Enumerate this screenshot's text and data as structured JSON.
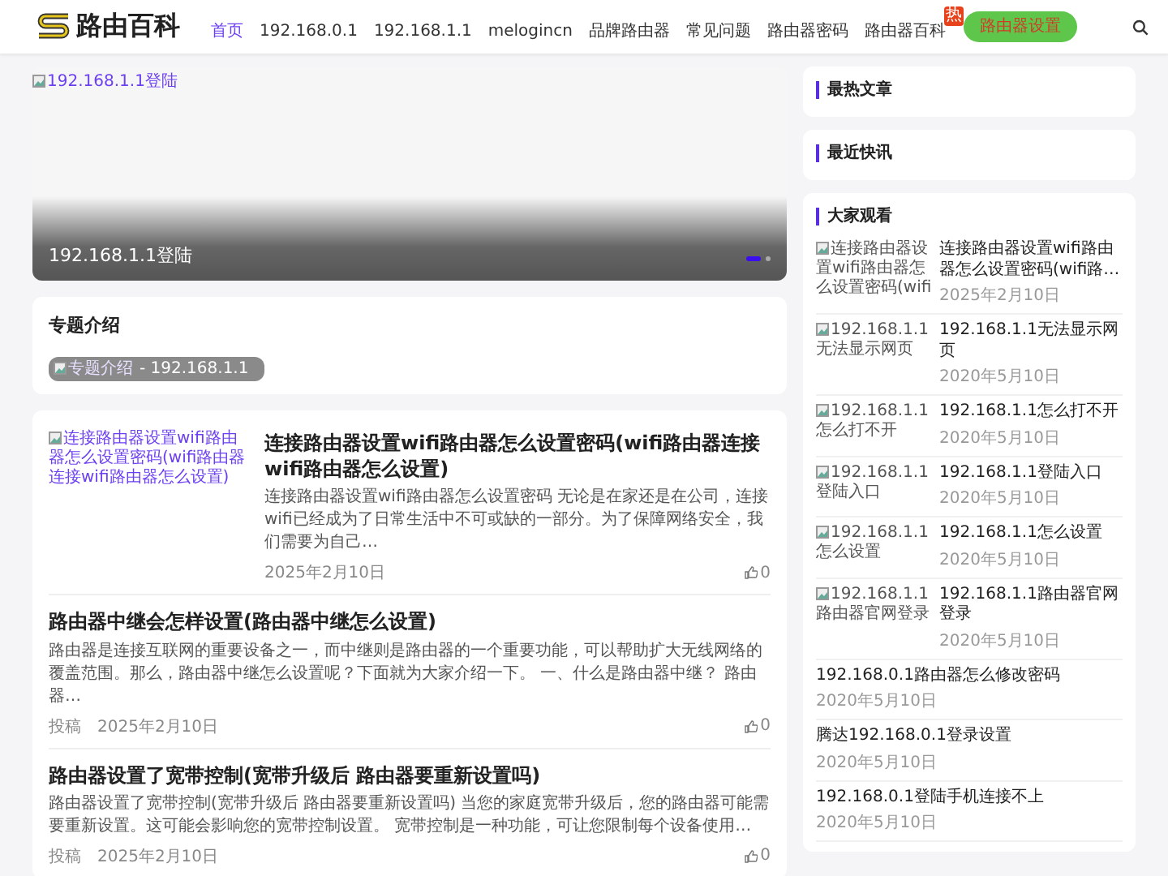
{
  "header": {
    "logo": "路由百科",
    "nav": [
      {
        "label": "首页",
        "selected": true
      },
      {
        "label": "192.168.0.1",
        "selected": false
      },
      {
        "label": "192.168.1.1",
        "selected": false
      },
      {
        "label": "melogincn",
        "selected": false
      },
      {
        "label": "品牌路由器",
        "selected": false
      },
      {
        "label": "常见问题",
        "selected": false
      },
      {
        "label": "路由器密码",
        "selected": false
      },
      {
        "label": "路由器百科",
        "selected": false,
        "badge": "热"
      }
    ],
    "cta": "路由器设置"
  },
  "slider": {
    "image_alt": "192.168.1.1登陆",
    "caption": "192.168.1.1登陆",
    "dots": [
      {
        "selected": true
      },
      {
        "selected": false
      }
    ]
  },
  "topic": {
    "title": "专题介绍",
    "image_alt": "专题介绍",
    "caption": "- 192.168.1.1"
  },
  "articles": [
    {
      "kind": "thumb",
      "image_alt": "连接路由器设置wifi路由器怎么设置密码(wifi路由器连接wifi路由器怎么设置)",
      "title": "连接路由器设置wifi路由器怎么设置密码(wifi路由器连接wifi路由器怎么设置)",
      "excerpt": "连接路由器设置wifi路由器怎么设置密码 无论是在家还是在公司，连接wifi已经成为了日常生活中不可或缺的一部分。为了保障网络安全，我们需要为自己…",
      "date": "2025年2月10日",
      "likes": "0"
    },
    {
      "kind": "plain",
      "title": "路由器中继会怎样设置(路由器中继怎么设置)",
      "excerpt": "路由器是连接互联网的重要设备之一，而中继则是路由器的一个重要功能，可以帮助扩大无线网络的覆盖范围。那么，路由器中继怎么设置呢？下面就为大家介绍一下。 一、什么是路由器中继？ 路由器…",
      "author": "投稿",
      "date": "2025年2月10日",
      "likes": "0"
    },
    {
      "kind": "plain",
      "title": "路由器设置了宽带控制(宽带升级后 路由器要重新设置吗)",
      "excerpt": "路由器设置了宽带控制(宽带升级后 路由器要重新设置吗) 当您的家庭宽带升级后，您的路由器可能需要重新设置。这可能会影响您的宽带控制设置。 宽带控制是一种功能，可让您限制每个设备使用…",
      "author": "投稿",
      "date": "2025年2月10日",
      "likes": "0"
    }
  ],
  "sidebar": [
    {
      "title": "最热文章"
    },
    {
      "title": "最近快讯"
    },
    {
      "title": "大家观看",
      "items": [
        {
          "image_alt": "连接路由器设置wifi路由器怎么设置密码(wifi",
          "title": "连接路由器设置wifi路由器怎么设置密码(wifi路…",
          "date": "2025年2月10日"
        },
        {
          "image_alt": "192.168.1.1无法显示网页",
          "title": "192.168.1.1无法显示网页",
          "date": "2020年5月10日"
        },
        {
          "image_alt": "192.168.1.1怎么打不开",
          "title": "192.168.1.1怎么打不开",
          "date": "2020年5月10日"
        },
        {
          "image_alt": "192.168.1.1登陆入口",
          "title": "192.168.1.1登陆入口",
          "date": "2020年5月10日"
        },
        {
          "image_alt": "192.168.1.1怎么设置",
          "title": "192.168.1.1怎么设置",
          "date": "2020年5月10日"
        },
        {
          "image_alt": "192.168.1.1路由器官网登录",
          "title": "192.168.1.1路由器官网登录",
          "date": "2020年5月10日"
        },
        {
          "title": "192.168.0.1路由器怎么修改密码",
          "date": "2020年5月10日"
        },
        {
          "title": "腾达192.168.0.1登录设置",
          "date": "2020年5月10日"
        },
        {
          "title": "192.168.0.1登陆手机连接不上",
          "date": "2020年5月10日"
        }
      ]
    }
  ]
}
